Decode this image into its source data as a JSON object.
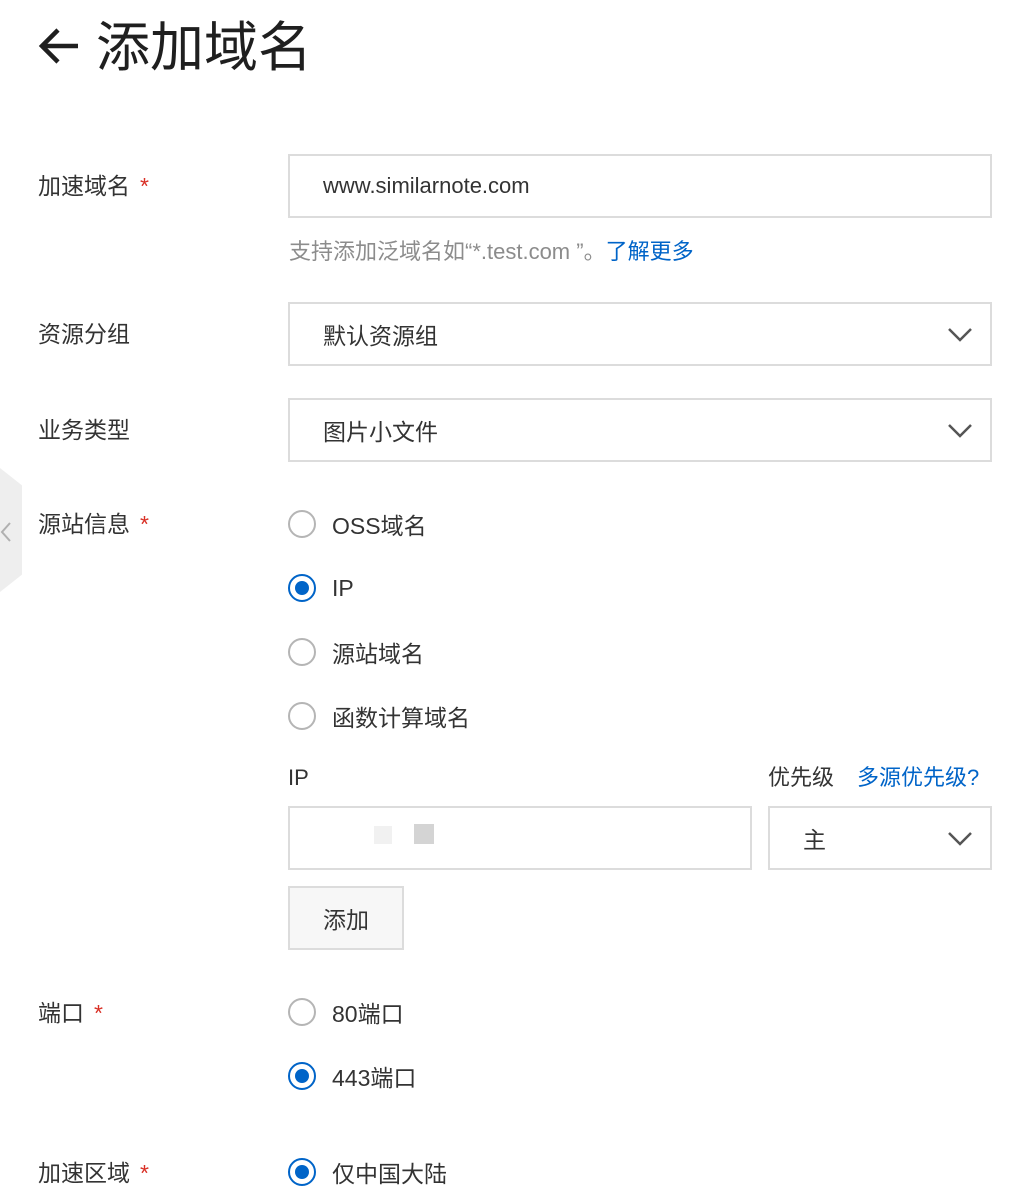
{
  "header": {
    "back_icon": "left-arrow-icon",
    "title": "添加域名"
  },
  "form": {
    "required_mark": "*",
    "domain": {
      "label": "加速域名",
      "value": "www.similarnote.com",
      "hint": "支持添加泛域名如“*.test.com ”。",
      "hint_link": "了解更多"
    },
    "resource_group": {
      "label": "资源分组",
      "selected": "默认资源组"
    },
    "business_type": {
      "label": "业务类型",
      "selected": "图片小文件"
    },
    "origin": {
      "label": "源站信息",
      "options": [
        {
          "label": "OSS域名",
          "checked": false
        },
        {
          "label": "IP",
          "checked": true
        },
        {
          "label": "源站域名",
          "checked": false
        },
        {
          "label": "函数计算域名",
          "checked": false
        }
      ],
      "ip_label": "IP",
      "ip_value": "",
      "priority_label": "优先级",
      "priority_link": "多源优先级?",
      "priority_selected": "主",
      "add_button": "添加"
    },
    "port": {
      "label": "端口",
      "options": [
        {
          "label": "80端口",
          "checked": false
        },
        {
          "label": "443端口",
          "checked": true
        }
      ]
    },
    "region": {
      "label": "加速区域",
      "options": [
        {
          "label": "仅中国大陆",
          "checked": true
        }
      ]
    }
  },
  "colors": {
    "accent": "#0064c8",
    "required": "#d93026",
    "border": "#dcdcdc",
    "hint_text": "#8c8c8c"
  }
}
